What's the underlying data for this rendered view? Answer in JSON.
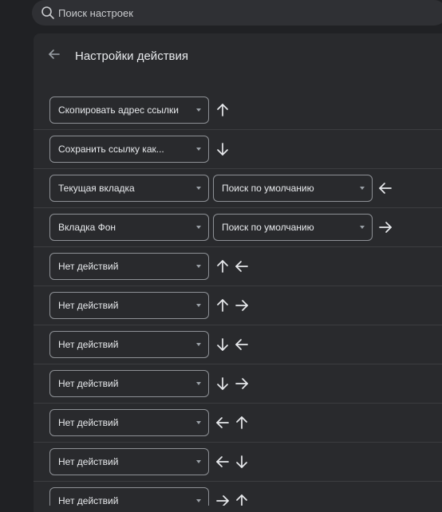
{
  "search": {
    "placeholder": "Поиск настроек"
  },
  "header": {
    "title": "Настройки действия"
  },
  "rows": [
    {
      "action": "Скопировать адрес ссылки",
      "target": null,
      "gesture": [
        "up"
      ]
    },
    {
      "action": "Сохранить ссылку как...",
      "target": null,
      "gesture": [
        "down"
      ]
    },
    {
      "action": "Текущая вкладка",
      "target": "Поиск по умолчанию",
      "gesture": [
        "left"
      ]
    },
    {
      "action": "Вкладка Фон",
      "target": "Поиск по умолчанию",
      "gesture": [
        "right"
      ]
    },
    {
      "action": "Нет действий",
      "target": null,
      "gesture": [
        "up",
        "left"
      ]
    },
    {
      "action": "Нет действий",
      "target": null,
      "gesture": [
        "up",
        "right"
      ]
    },
    {
      "action": "Нет действий",
      "target": null,
      "gesture": [
        "down",
        "left"
      ]
    },
    {
      "action": "Нет действий",
      "target": null,
      "gesture": [
        "down",
        "right"
      ]
    },
    {
      "action": "Нет действий",
      "target": null,
      "gesture": [
        "left",
        "up"
      ]
    },
    {
      "action": "Нет действий",
      "target": null,
      "gesture": [
        "left",
        "down"
      ]
    },
    {
      "action": "Нет действий",
      "target": null,
      "gesture": [
        "right",
        "up"
      ]
    }
  ],
  "icons": {
    "search": "search-icon",
    "back": "arrow-left-icon",
    "dropdown": "caret-down-icon"
  },
  "colors": {
    "page_bg": "#202124",
    "panel_bg": "#292a2d",
    "text": "#e8eaed",
    "border": "#8e9196",
    "divider": "#3c3d40"
  }
}
